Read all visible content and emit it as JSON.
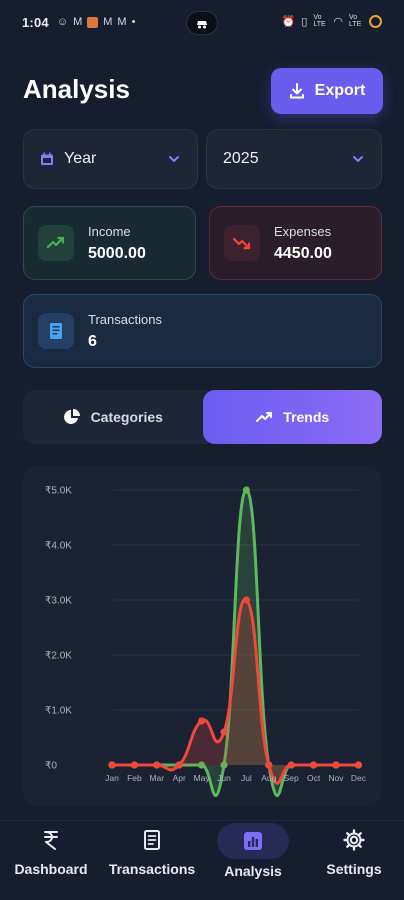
{
  "status_bar": {
    "time": "1:04",
    "notification_icons": [
      "discord-icon",
      "gmail-icon",
      "app-icon",
      "gmail-icon",
      "gmail-icon",
      "dot-icon"
    ],
    "right_icons": [
      "alarm-icon",
      "vibrate-icon",
      "volte-icon",
      "wifi-icon",
      "signal-icon",
      "battery-icon"
    ],
    "volte_text": "Vo LTE",
    "signal_text": "Vo LTE"
  },
  "header": {
    "title": "Analysis",
    "export_label": "Export"
  },
  "filters": {
    "period": {
      "value": "Year",
      "icon": "calendar-icon"
    },
    "year": {
      "value": "2025"
    }
  },
  "stats": {
    "income": {
      "label": "Income",
      "value": "5000.00",
      "icon": "trending-up-icon",
      "color": "#4caf50"
    },
    "expenses": {
      "label": "Expenses",
      "value": "4450.00",
      "icon": "trending-down-icon",
      "color": "#f44336"
    },
    "transactions": {
      "label": "Transactions",
      "value": "6",
      "icon": "receipt-icon",
      "color": "#4aa3f0"
    }
  },
  "tabs": [
    {
      "label": "Categories",
      "icon": "pie-chart-icon",
      "active": false
    },
    {
      "label": "Trends",
      "icon": "trend-line-icon",
      "active": true
    }
  ],
  "chart_data": {
    "type": "area",
    "categories": [
      "Jan",
      "Feb",
      "Mar",
      "Apr",
      "May",
      "Jun",
      "Jul",
      "Aug",
      "Sep",
      "Oct",
      "Nov",
      "Dec"
    ],
    "yticks": [
      "₹0",
      "₹1.0K",
      "₹2.0K",
      "₹3.0K",
      "₹4.0K",
      "₹5.0K"
    ],
    "ylim": [
      0,
      5000
    ],
    "grid": true,
    "series": [
      {
        "values": [
          0,
          0,
          0,
          0,
          0,
          0,
          5000,
          0,
          0,
          0,
          0,
          0
        ],
        "color": "#5cb85c"
      },
      {
        "values": [
          0,
          0,
          0,
          0,
          800,
          600,
          3000,
          0,
          0,
          0,
          0,
          0
        ],
        "color": "#f0493a"
      }
    ]
  },
  "nav": {
    "items": [
      {
        "label": "Dashboard",
        "icon": "rupee-icon"
      },
      {
        "label": "Transactions",
        "icon": "receipt-icon"
      },
      {
        "label": "Analysis",
        "icon": "analytics-icon",
        "active": true
      },
      {
        "label": "Settings",
        "icon": "gear-icon"
      }
    ]
  }
}
